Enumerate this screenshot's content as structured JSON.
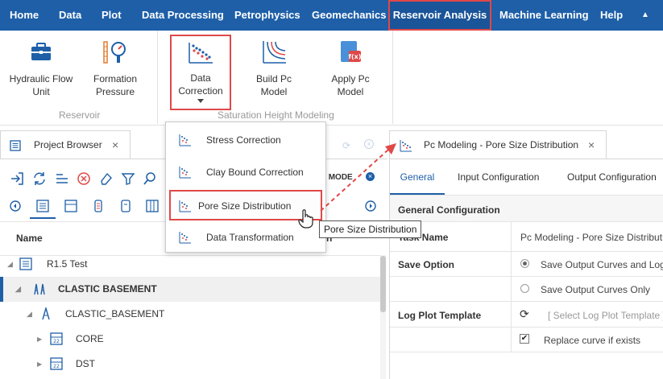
{
  "menubar": {
    "items": [
      "Home",
      "Data",
      "Plot",
      "Data Processing",
      "Petrophysics",
      "Geomechanics",
      "Reservoir Analysis",
      "Machine Learning",
      "Help"
    ],
    "collapse_glyph": "▲"
  },
  "ribbon": {
    "reservoir_group": {
      "label": "Reservoir",
      "buttons": [
        {
          "label": "Hydraulic Flow Unit",
          "icon": "toolbox-icon"
        },
        {
          "label": "Formation Pressure",
          "icon": "pressure-gauge-icon"
        }
      ]
    },
    "saturation_group": {
      "label": "Saturation Height Modeling",
      "buttons": [
        {
          "label": "Data Correction",
          "icon": "scatter-plot-icon"
        },
        {
          "label": "Build Pc Model",
          "icon": "pc-curves-icon"
        },
        {
          "label": "Apply Pc Model",
          "icon": "function-doc-icon"
        }
      ]
    }
  },
  "dropdown": {
    "items": [
      "Stress Correction",
      "Clay Bound Correction",
      "Pore Size Distribution",
      "Data Transformation"
    ],
    "highlighted": "Pore Size Distribution"
  },
  "tooltip": "Pore Size Distribution",
  "left_panel": {
    "tab_label": "Project Browser",
    "partial_header": "L MODE",
    "column_header": "Name",
    "tree": [
      {
        "label": "R1.5 Test",
        "icon": "project-icon",
        "expanded": true
      },
      {
        "label": "CLASTIC BASEMENT",
        "icon": "well-group-icon",
        "selected": true
      },
      {
        "label": "CLASTIC_BASEMENT",
        "icon": "well-icon",
        "expanded": true
      },
      {
        "label": "CORE",
        "icon": "data-set-icon"
      },
      {
        "label": "DST",
        "icon": "data-set-icon"
      }
    ]
  },
  "right_panel": {
    "tab_label": "Pc Modeling - Pore Size Distribution",
    "tabs": [
      "General",
      "Input Configuration",
      "Output Configuration"
    ],
    "section_title": "General Configuration",
    "task_name": {
      "label": "Task Name",
      "value": "Pc Modeling - Pore Size Distributio"
    },
    "save_option": {
      "label": "Save Option",
      "options": [
        "Save Output Curves and Log",
        "Save Output Curves Only"
      ],
      "selected": 0
    },
    "log_plot_template": {
      "label": "Log Plot Template",
      "placeholder": "[ Select Log Plot Template ]"
    },
    "replace_curve": {
      "label": "Replace curve if exists",
      "checked": true
    }
  },
  "colors": {
    "menubar": "#1e5fa8",
    "highlight": "#e04848",
    "accent": "#1e5fa8",
    "arrow": "#e04848"
  }
}
